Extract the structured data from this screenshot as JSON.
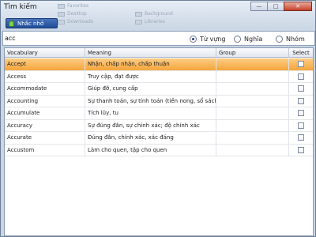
{
  "window": {
    "title": "Tìm kiếm",
    "minimize": "—",
    "maximize": "□",
    "close": "✕"
  },
  "background_items": [
    "Favorites",
    "Desktop",
    "Downloads",
    "Background",
    "Libraries"
  ],
  "reminder_button": "Nhắc nhở",
  "search": {
    "value": "acc",
    "options": [
      {
        "label": "Từ vựng",
        "selected": true
      },
      {
        "label": "Nghĩa",
        "selected": false
      },
      {
        "label": "Nhóm",
        "selected": false
      }
    ]
  },
  "table": {
    "columns": [
      "Vocabulary",
      "Meaning",
      "Group",
      "Select"
    ],
    "rows": [
      {
        "vocabulary": "Accept",
        "meaning": "Nhận, chấp nhận, chấp thuận",
        "group": "",
        "selected": false
      },
      {
        "vocabulary": "Access",
        "meaning": "Truy cập, đạt được",
        "group": "",
        "selected": false
      },
      {
        "vocabulary": "Accommodate",
        "meaning": "Giúp đỡ, cung cấp",
        "group": "",
        "selected": false
      },
      {
        "vocabulary": "Accounting",
        "meaning": "Sự thanh toán, sự tính toán (tiền nong, sổ sách)",
        "group": "",
        "selected": false
      },
      {
        "vocabulary": "Accumulate",
        "meaning": "Tích lũy, tu",
        "group": "",
        "selected": false
      },
      {
        "vocabulary": "Accuracy",
        "meaning": "Sự đúng đắn, sự chính xác; độ chính xác",
        "group": "",
        "selected": false
      },
      {
        "vocabulary": "Accurate",
        "meaning": "Đúng đắn, chính xác, xác đáng",
        "group": "",
        "selected": false
      },
      {
        "vocabulary": "Accustom",
        "meaning": "Làm cho quen, tập cho quen",
        "group": "",
        "selected": false
      }
    ],
    "highlighted_row": 0
  },
  "colors": {
    "highlight": "#f5a53b",
    "accent": "#1f4d99"
  }
}
